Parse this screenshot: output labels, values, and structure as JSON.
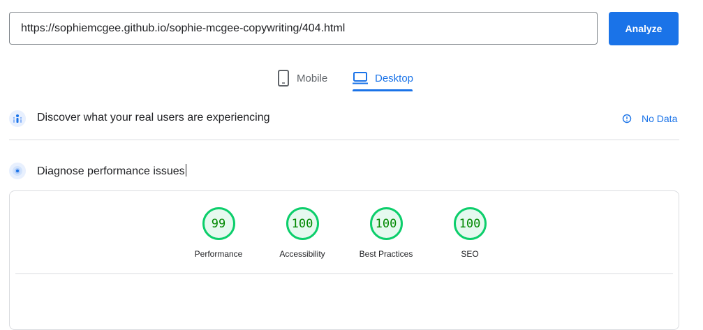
{
  "search": {
    "url_value": "https://sophiemcgee.github.io/sophie-mcgee-copywriting/404.html",
    "analyze_label": "Analyze"
  },
  "tabs": [
    {
      "label": "Mobile",
      "icon": "phone-icon",
      "active": false
    },
    {
      "label": "Desktop",
      "icon": "laptop-icon",
      "active": true
    }
  ],
  "field_data": {
    "title": "Discover what your real users are experiencing",
    "status": "No Data",
    "icon": "users-icon",
    "status_icon": "info-icon"
  },
  "lab_data": {
    "title": "Diagnose performance issues",
    "icon": "lighthouse-icon"
  },
  "scores": [
    {
      "value": "99",
      "label": "Performance"
    },
    {
      "value": "100",
      "label": "Accessibility"
    },
    {
      "value": "100",
      "label": "Best Practices"
    },
    {
      "value": "100",
      "label": "SEO"
    }
  ],
  "colors": {
    "accent": "#1a73e8",
    "pass": "#0cce6b",
    "pass_bg": "#e6f9ef",
    "pass_text": "#008800"
  }
}
